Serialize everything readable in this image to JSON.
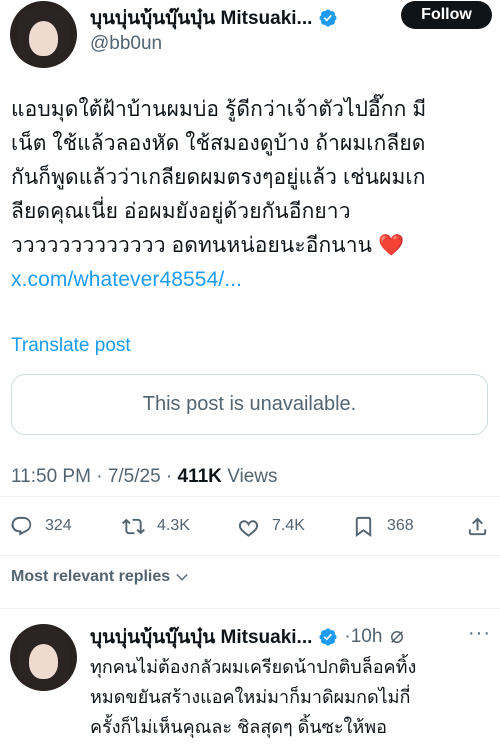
{
  "post": {
    "author": {
      "display_name": "บุนบุ่นบุ้นบุ๊นบุ๋น Mitsuaki...",
      "handle": "@bb0un",
      "verified": true
    },
    "follow_label": "Follow",
    "text_lines": [
      "แอบมุดใต้ฝ้าบ้านผมบ่อ รู้ดีกว่าเจ้าตัวไปอี๊กก มี",
      "เน็ต ใช้แล้วลองหัด ใช้สมองดูบ้าง ถ้าผมเกลียด",
      "กันก็พูดแล้วว่าเกลียดผมตรงๆอยู่แล้ว เช่นผมเก",
      "ลียดคุณเนี่ย อ่อผมยังอยู่ด้วยกันอีกยาว",
      "ววววววววววววว อดทนหน่อยนะอีกนาน"
    ],
    "heart_emoji": "❤️",
    "link_text": "x.com/whatever48554/...",
    "translate_label": "Translate post",
    "quoted_unavailable": "This post is unavailable.",
    "time": "11:50 PM",
    "date": "7/5/25",
    "views_count": "411K",
    "views_label": "Views",
    "stats": {
      "replies": "324",
      "reposts": "4.3K",
      "likes": "7.4K",
      "bookmarks": "368"
    }
  },
  "replies_sort_label": "Most relevant replies",
  "reply": {
    "display_name": "บุนบุ่นบุ้นบุ๊นบุ๋น Mitsuaki...",
    "verified": true,
    "time_ago": "·10h",
    "text_lines": [
      "ทุกคนไม่ต้องกลัวผมเครียดน้าปกติบล็อคทิ้ง",
      "หมดขยันสร้างแอคใหม่มาก็มาดิผมกดไม่กี่",
      "ครั้งก็ไม่เห็นคุณละ ชิลสุดๆ ดิ้นซะให้พอ"
    ]
  },
  "colors": {
    "accent": "#1d9bf0",
    "text": "#0f1419",
    "muted": "#536471",
    "border": "#cfd9de"
  },
  "icons": [
    "verified-badge-icon",
    "reply-icon",
    "repost-icon",
    "like-icon",
    "bookmark-icon",
    "share-icon",
    "chevron-down-icon",
    "grok-icon",
    "more-icon"
  ]
}
